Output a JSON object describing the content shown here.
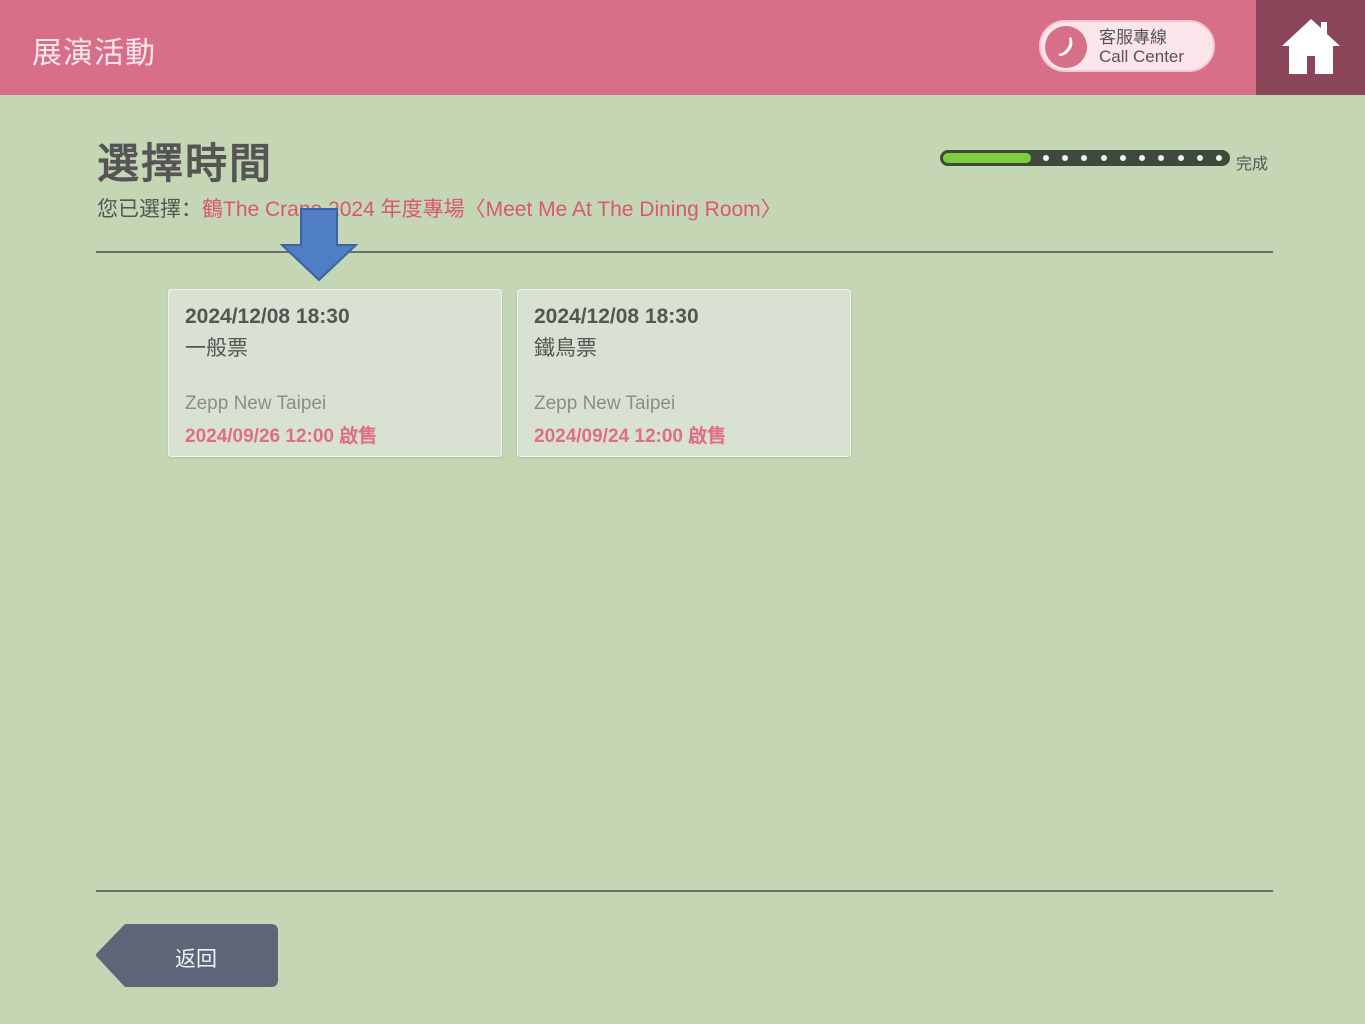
{
  "header": {
    "title": "展演活動",
    "call_center": {
      "line1": "客服專線",
      "line2": "Call Center",
      "icon": "phone-icon"
    },
    "home_icon": "home-icon",
    "background_color": "#d86f89",
    "home_background_color": "#8a4658"
  },
  "main": {
    "page_title": "選擇時間",
    "selected_label": "您已選擇：",
    "selected_value": "鶴The Crane 2024 年度專場〈Meet Me At The Dining Room〉",
    "progress": {
      "fraction": 0.31,
      "end_label": "完成",
      "dot_count": 10
    },
    "cards": [
      {
        "datetime": "2024/12/08 18:30",
        "ticket_type": "一般票",
        "venue": "Zepp New Taipei",
        "sale_info": "2024/09/26 12:00 啟售"
      },
      {
        "datetime": "2024/12/08 18:30",
        "ticket_type": "鐵鳥票",
        "venue": "Zepp New Taipei",
        "sale_info": "2024/09/24 12:00 啟售"
      }
    ]
  },
  "footer": {
    "back_label": "返回"
  },
  "colors": {
    "page_background": "#c5d6b5",
    "accent_red": "#d9576f",
    "progress_green": "#7ccf3e",
    "back_button": "#5d6679"
  }
}
